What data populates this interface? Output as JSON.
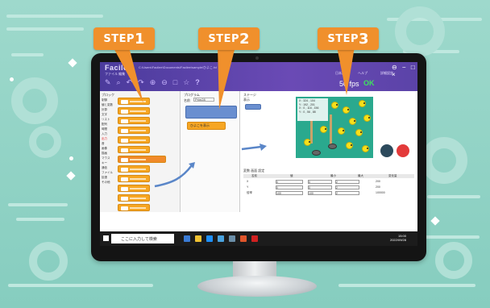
{
  "app": {
    "logo": "Facilee",
    "path_bar": "C:\\Users\\Facilee\\Documents\\Facilee\\sample\\ひよこ.fcl",
    "menu": "ファイル  編集",
    "right_menu": [
      "日本語",
      "ヘルプ",
      "詳細設定"
    ],
    "window_controls": "⊖ − □ ×",
    "fps": "50 fps",
    "status": "OK"
  },
  "toolbar_icons": [
    "pencil-icon",
    "zoom-icon",
    "undo-icon",
    "redo-icon",
    "run-icon",
    "stop-icon",
    "window-icon",
    "star-icon",
    "help-icon"
  ],
  "blocks_pane": {
    "title": "ブロック",
    "categories": [
      "制御",
      "値と変数",
      "計算",
      "文字",
      "リスト",
      "配列",
      "時間",
      "入力",
      "出力",
      "音",
      "画像",
      "描画",
      "マウス",
      "キー",
      "通信",
      "ファイル",
      "拡張",
      "その他"
    ],
    "highlighted_category": "出力"
  },
  "program_pane": {
    "title": "プログラム",
    "name_label": "名前",
    "name_value": "Prim28",
    "block_label": "ひよこを表示"
  },
  "stage_pane": {
    "title": "ステージ",
    "sub": "表示",
    "info_lines": [
      "X : 324 , 104",
      "Y : 192 , 201",
      "X : 0 , 116 , 156",
      "Y : 0 , 56 , 88"
    ],
    "table_tabs": "変数  画面  設定",
    "table_headers": [
      "名前",
      "値",
      "最小",
      "最大",
      "変化量"
    ],
    "table_rows": [
      {
        "name": "X",
        "value": "0",
        "min": "0",
        "max": "2",
        "step": "200"
      },
      {
        "name": "Y",
        "value": "0",
        "min": "0",
        "max": "2",
        "step": "200"
      },
      {
        "name": "倍率",
        "value": "100",
        "min": "100",
        "max": "2",
        "step": "100000"
      }
    ]
  },
  "taskbar": {
    "search_placeholder": "ここに入力して検索",
    "time": "15:00",
    "date": "2022/09/28"
  },
  "steps": [
    {
      "word": "STEP",
      "num": "1"
    },
    {
      "word": "STEP",
      "num": "2"
    },
    {
      "word": "STEP",
      "num": "3"
    }
  ],
  "colors": {
    "background": "#8fd3c6",
    "step_orange": "#f0902c",
    "titlebar_purple": "#5b43a8",
    "block_orange": "#f6a623",
    "ok_green": "#3ee45d"
  }
}
